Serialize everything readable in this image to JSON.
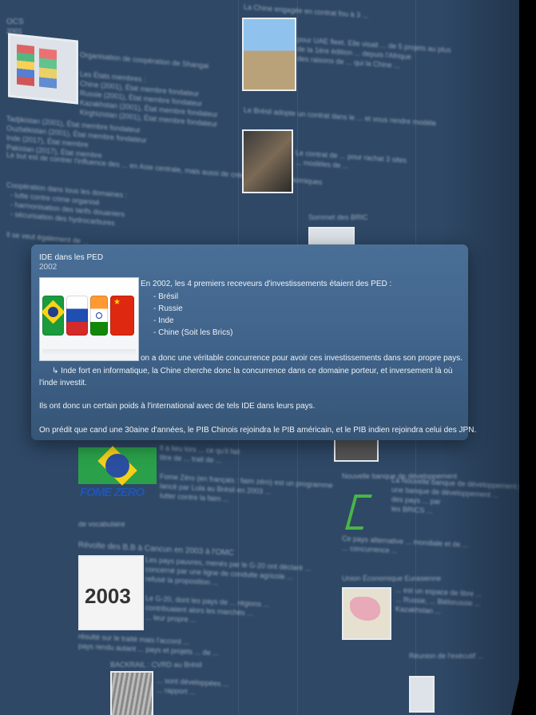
{
  "card": {
    "title": "IDE dans les PED",
    "year": "2002",
    "intro": "En 2002, les 4 premiers receveurs d'investissements étaient des PED :",
    "countries": [
      "- Brésil",
      "- Russie",
      "- Inde",
      "- Chine (Soit les Brics)"
    ],
    "image_letters": "BRIC",
    "para1": "on a donc une véritable concurrence pour avoir ces investissements dans son propre pays.",
    "para2": "↳ Inde fort en informatique, la Chine cherche donc la concurrence dans ce domaine porteur, et inversement là où l'inde investit.",
    "para3": "Ils ont donc un certain poids à l'international avec de tels IDE dans leurs pays.",
    "para4": "On prédit que cand une 30aine d'années, le PIB Chinois rejoindra le PIB américain, et le PIB indien rejoindra celui des JPN."
  },
  "background": {
    "top_left_title": "OCS",
    "top_left_year": "2001",
    "fome_zero": "FOME ZERO",
    "wto_year": "2003",
    "wto_label": "Révolte des B.B à Cancun en 2003 à l'OMC",
    "colors": {
      "canvas": "#2e4866",
      "card_top": "#4a6f97",
      "card_bottom": "#365576"
    }
  }
}
